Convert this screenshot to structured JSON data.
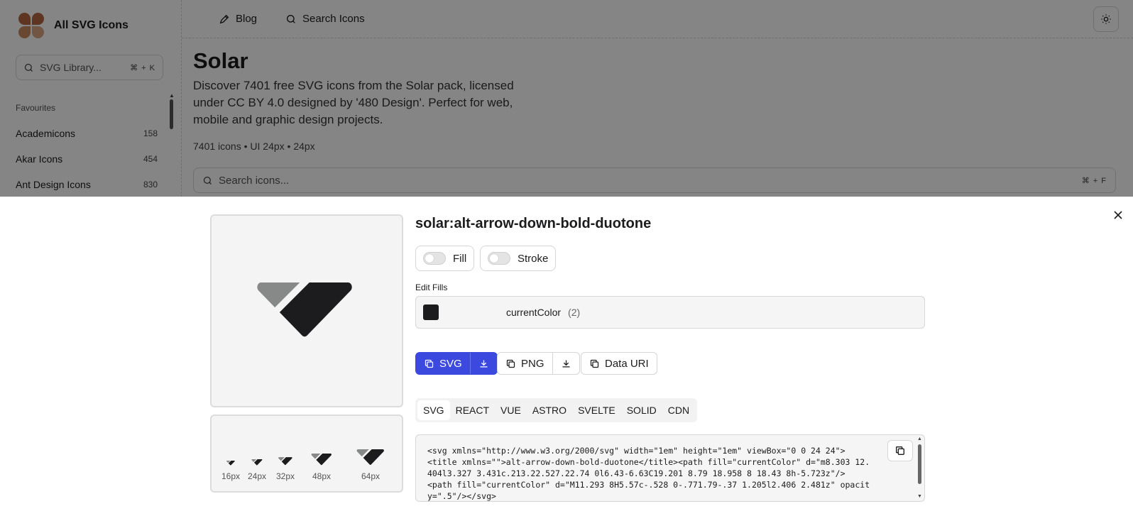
{
  "sidebar": {
    "brand": "All SVG Icons",
    "search_placeholder": "SVG Library...",
    "search_shortcut": "⌘ + K",
    "section_label": "Favourites",
    "items": [
      {
        "label": "Academicons",
        "count": "158"
      },
      {
        "label": "Akar Icons",
        "count": "454"
      },
      {
        "label": "Ant Design Icons",
        "count": "830"
      }
    ]
  },
  "topbar": {
    "blog": "Blog",
    "search": "Search Icons"
  },
  "page": {
    "title": "Solar",
    "description": "Discover 7401 free SVG icons from the Solar pack, licensed under CC BY 4.0 designed by '480 Design'. Perfect for web, mobile and graphic design projects.",
    "meta": "7401 icons • UI 24px • 24px",
    "search_placeholder": "Search icons...",
    "search_shortcut": "⌘ + F"
  },
  "drawer": {
    "icon_name": "solar:alt-arrow-down-bold-duotone",
    "toggles": {
      "fill": "Fill",
      "stroke": "Stroke"
    },
    "edit_fills_label": "Edit Fills",
    "fill": {
      "color_name": "currentColor",
      "count": "(2)",
      "swatch": "#1c1c1e"
    },
    "buttons": {
      "svg": "SVG",
      "png": "PNG",
      "data_uri": "Data URI"
    },
    "sizes": [
      "16px",
      "24px",
      "32px",
      "48px",
      "64px"
    ],
    "tabs": [
      "SVG",
      "REACT",
      "VUE",
      "ASTRO",
      "SVELTE",
      "SOLID",
      "CDN"
    ],
    "code": "<svg xmlns=\"http://www.w3.org/2000/svg\" width=\"1em\" height=\"1em\" viewBox=\"0 0 24 24\">\n<title xmlns=\"\">alt-arrow-down-bold-duotone</title><path fill=\"currentColor\" d=\"m8.303 12.404l3.327 3.431c.213.22.527.22.74 0l6.43-6.63C19.201 8.79 18.958 8 18.43 8h-5.723z\"/>\n<path fill=\"currentColor\" d=\"M11.293 8H5.57c-.528 0-.771.79-.37 1.205l2.406 2.481z\" opacity=\".5\"/></svg>"
  },
  "colors": {
    "accent": "#3b49df",
    "overlay": "rgba(0,0,0,0.48)"
  }
}
